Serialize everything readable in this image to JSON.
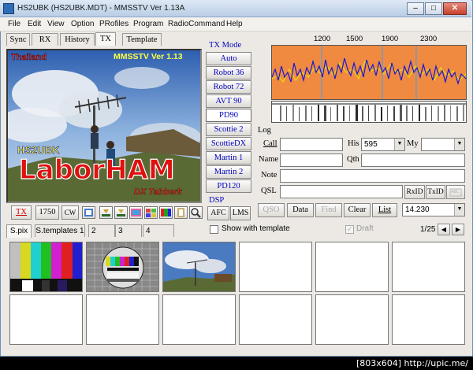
{
  "window": {
    "title": "HS2UBK (HS2UBK.MDT) - MMSSTV Ver 1.13A",
    "min_glyph": "–",
    "max_glyph": "□",
    "close_glyph": "✕"
  },
  "menu": [
    "File",
    "Edit",
    "View",
    "Option",
    "PRofiles",
    "Program",
    "RadioCommand",
    "Help"
  ],
  "tabs": [
    "Sync",
    "RX",
    "History",
    "TX",
    "Template"
  ],
  "picture": {
    "country_label": "Thailand",
    "version_label": "MMSSTV Ver 1.13",
    "callsign": "HS2UBK",
    "main_text": "LaborHAM",
    "sub_text": "DX Tabberk"
  },
  "tx_controls": {
    "tx_label": "TX",
    "freq_label": "1750",
    "cw_label": "CW"
  },
  "tx_mode": {
    "title": "TX Mode",
    "modes": [
      "Auto",
      "Robot 36",
      "Robot 72",
      "AVT 90",
      "PD90",
      "Scottie 2",
      "ScottieDX",
      "Martin 1",
      "Martin 2",
      "PD120"
    ],
    "selected": "PD90"
  },
  "dsp": {
    "title": "DSP",
    "afc_label": "AFC",
    "lms_label": "LMS"
  },
  "spectrum": {
    "ticks": [
      "1200",
      "1500",
      "1900",
      "2300"
    ]
  },
  "log": {
    "title": "Log",
    "call_label": "Call",
    "his_label": "His",
    "his_value": "595",
    "my_label": "My",
    "my_value": "",
    "name_label": "Name",
    "qth_label": "Qth",
    "note_label": "Note",
    "qsl_label": "QSL",
    "rxid_label": "RxID",
    "txid_label": "TxID",
    "qso_label": "QSO",
    "data_label": "Data",
    "find_label": "Find",
    "clear_label": "Clear",
    "list_label": "List",
    "freq_value": "14.230",
    "call_value": "",
    "name_value": "",
    "qth_value": "",
    "note_value": "",
    "qsl_value": ""
  },
  "lower_tabs": [
    "S.pix",
    "S.templates 1",
    "2",
    "3",
    "4"
  ],
  "template_options": {
    "show_with_template": "Show with template",
    "draft": "Draft",
    "page": "1/25",
    "prev_glyph": "◀",
    "next_glyph": "▶"
  },
  "watermark": "[803x604] http://upic.me/"
}
